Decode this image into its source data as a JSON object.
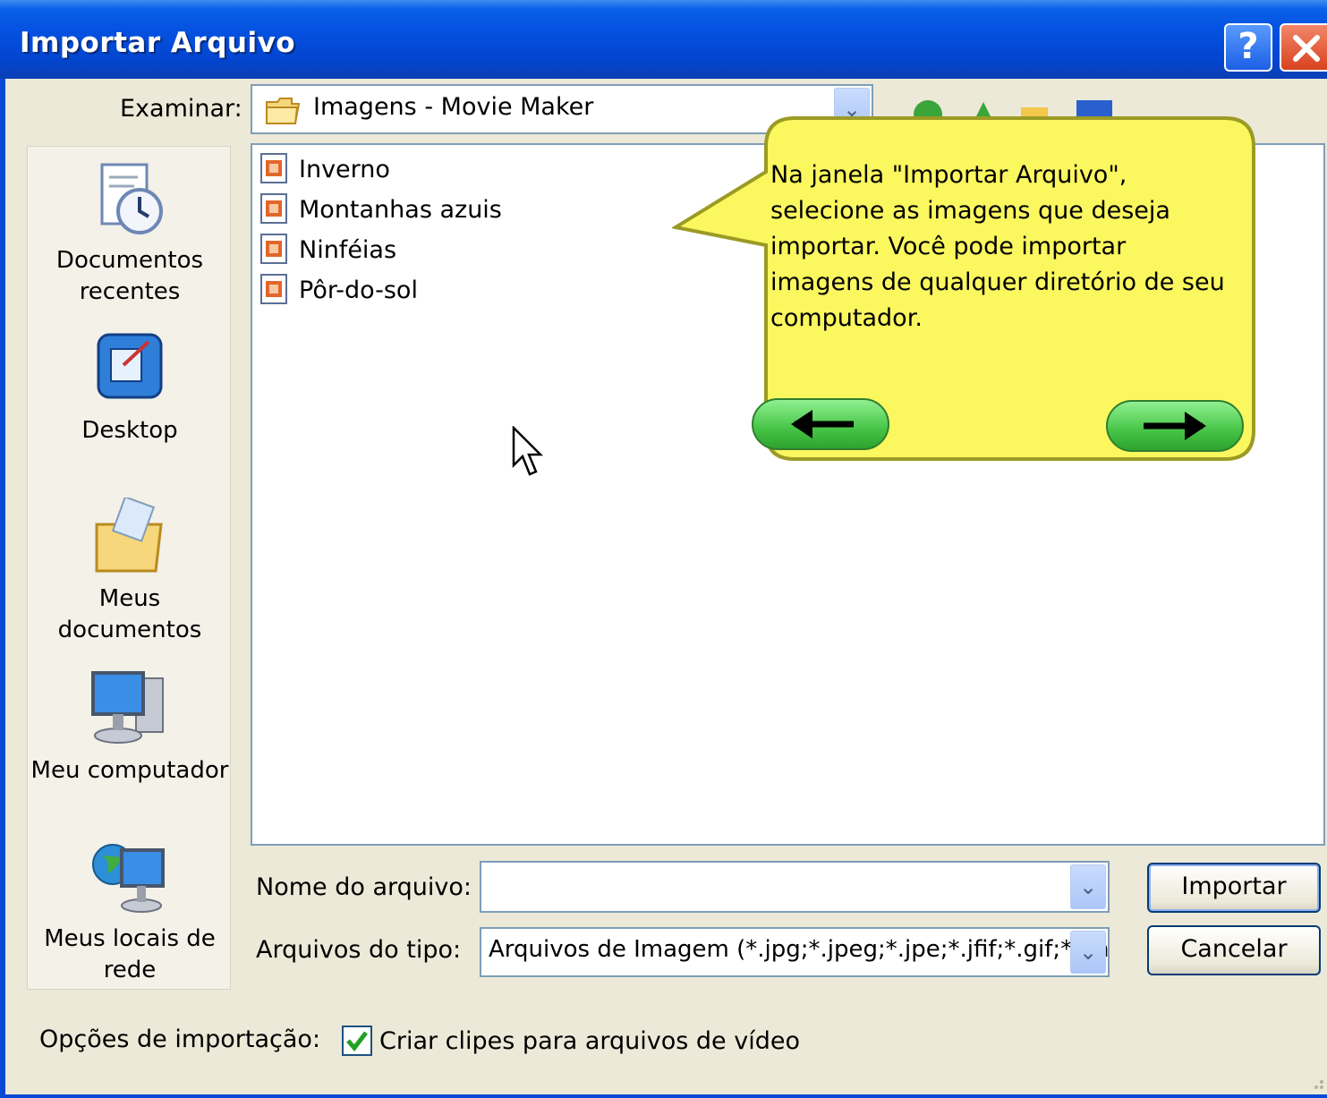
{
  "window": {
    "title": "Importar Arquivo",
    "help_button": "?",
    "close_button": "✕"
  },
  "lookin": {
    "label": "Examinar:",
    "value": "Imagens - Movie Maker"
  },
  "places": [
    {
      "label": "Documentos recentes",
      "icon": "recent-documents-icon"
    },
    {
      "label": "Desktop",
      "icon": "desktop-icon"
    },
    {
      "label": "Meus documentos",
      "icon": "my-documents-icon"
    },
    {
      "label": "Meu computador",
      "icon": "my-computer-icon"
    },
    {
      "label": "Meus locais de rede",
      "icon": "network-places-icon"
    }
  ],
  "files": [
    {
      "name": "Inverno",
      "icon": "image-file-icon"
    },
    {
      "name": "Montanhas azuis",
      "icon": "image-file-icon"
    },
    {
      "name": "Ninféias",
      "icon": "image-file-icon"
    },
    {
      "name": "Pôr-do-sol",
      "icon": "image-file-icon"
    }
  ],
  "filename": {
    "label": "Nome do arquivo:",
    "value": ""
  },
  "filetype": {
    "label": "Arquivos do tipo:",
    "value": "Arquivos de Imagem (*.jpg;*.jpeg;*.jpe;*.jfif;*.gif;*.pn"
  },
  "buttons": {
    "import": "Importar",
    "cancel": "Cancelar"
  },
  "options": {
    "label": "Opções de importação:",
    "checkbox_label": "Criar clipes para arquivos de vídeo",
    "checked": true
  },
  "tutorial_callout": {
    "text": "Na janela \"Importar Arquivo\", selecione as imagens que deseja importar. Você pode importar imagens de qualquer diretório de seu computador.",
    "back_icon": "arrow-left-icon",
    "next_icon": "arrow-right-icon"
  },
  "colors": {
    "titlebar": "#0551e0",
    "dialog_bg": "#ece9d8",
    "callout_fill": "#fbf75f",
    "nav_button": "#46c446"
  }
}
